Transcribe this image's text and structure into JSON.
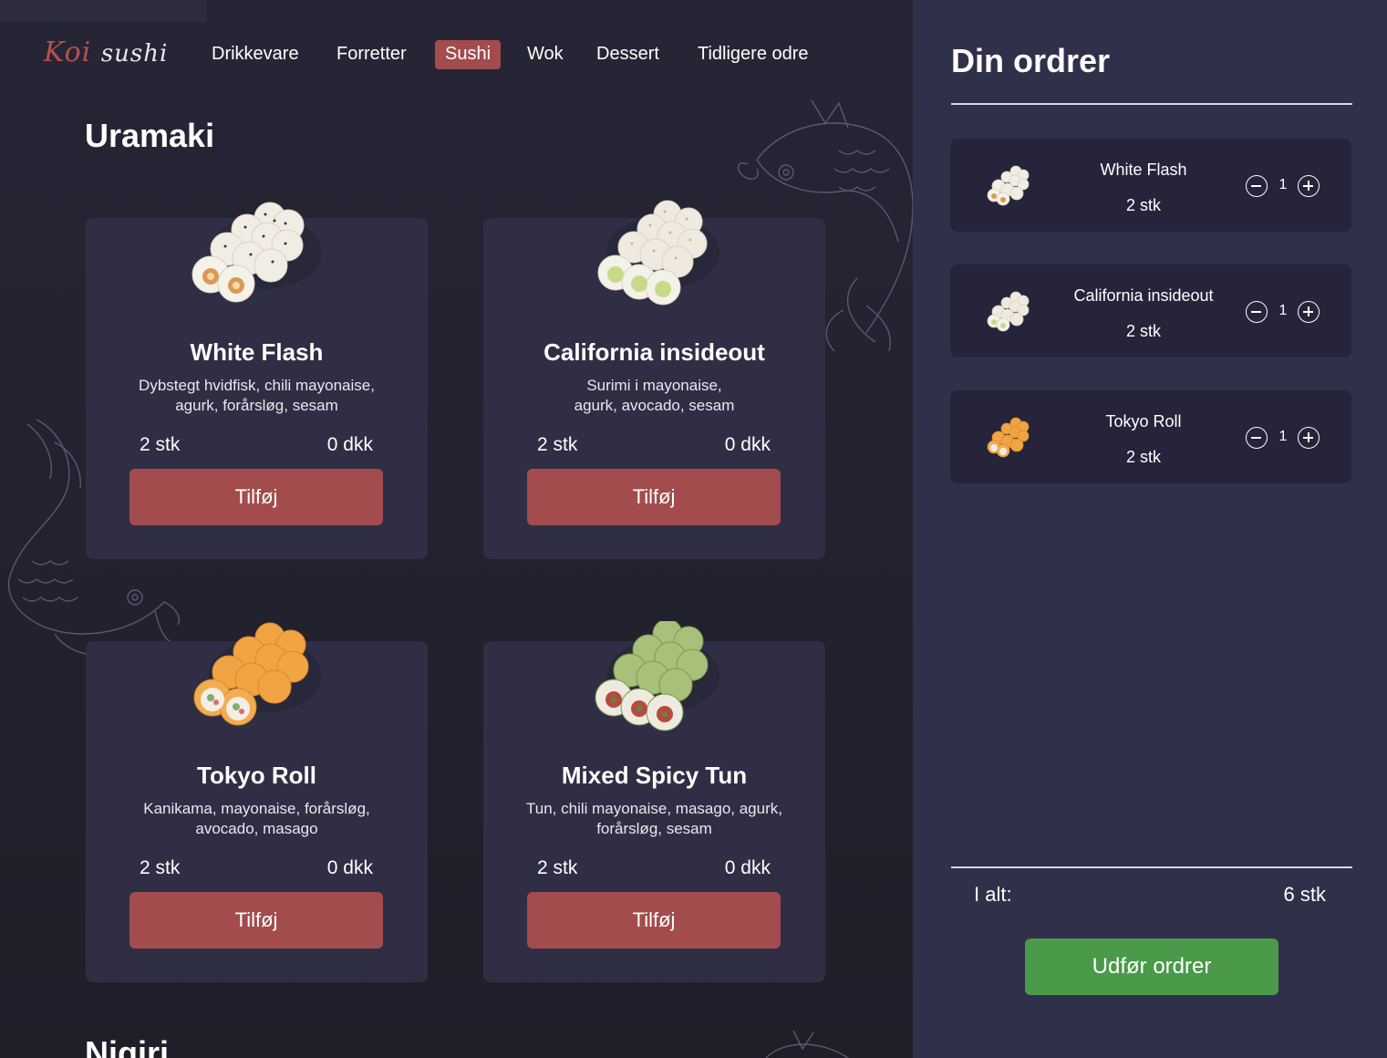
{
  "brand": {
    "logo_koi": "Koi",
    "logo_sushi": "sushi"
  },
  "nav": {
    "items": [
      {
        "label": "Drikkevare"
      },
      {
        "label": "Forretter"
      },
      {
        "label": "Sushi",
        "active": true
      },
      {
        "label": "Wok"
      },
      {
        "label": "Dessert"
      },
      {
        "label": "Tidligere odre"
      }
    ]
  },
  "section": {
    "title": "Uramaki",
    "next_title": "Nigiri"
  },
  "products": [
    {
      "name": "White Flash",
      "desc_line1": "Dybstegt hvidfisk, chili mayonaise,",
      "desc_line2": "agurk, forårsløg, sesam",
      "qty": "2 stk",
      "price": "0 dkk",
      "button": "Tilføj"
    },
    {
      "name": "California insideout",
      "desc_line1": "Surimi i mayonaise,",
      "desc_line2": "agurk, avocado, sesam",
      "qty": "2 stk",
      "price": "0 dkk",
      "button": "Tilføj"
    },
    {
      "name": "Tokyo Roll",
      "desc_line1": "Kanikama, mayonaise, forårsløg,",
      "desc_line2": "avocado, masago",
      "qty": "2 stk",
      "price": "0 dkk",
      "button": "Tilføj"
    },
    {
      "name": "Mixed Spicy Tun",
      "desc_line1": "Tun, chili mayonaise, masago, agurk,",
      "desc_line2": "forårsløg, sesam",
      "qty": "2 stk",
      "price": "0 dkk",
      "button": "Tilføj"
    }
  ],
  "order": {
    "title": "Din ordrer",
    "items": [
      {
        "name": "White Flash",
        "qty": "2 stk",
        "count": "1"
      },
      {
        "name": "California insideout",
        "qty": "2 stk",
        "count": "1"
      },
      {
        "name": "Tokyo Roll",
        "qty": "2 stk",
        "count": "1"
      }
    ],
    "total_label": "I alt:",
    "total_value": "6 stk",
    "submit": "Udfør ordrer"
  },
  "colors": {
    "accent": "#a24c4d",
    "checkout": "#4a9a4a",
    "card_bg": "#2f2e44",
    "sidebar_bg": "#31304a",
    "order_item_bg": "#25243a"
  }
}
